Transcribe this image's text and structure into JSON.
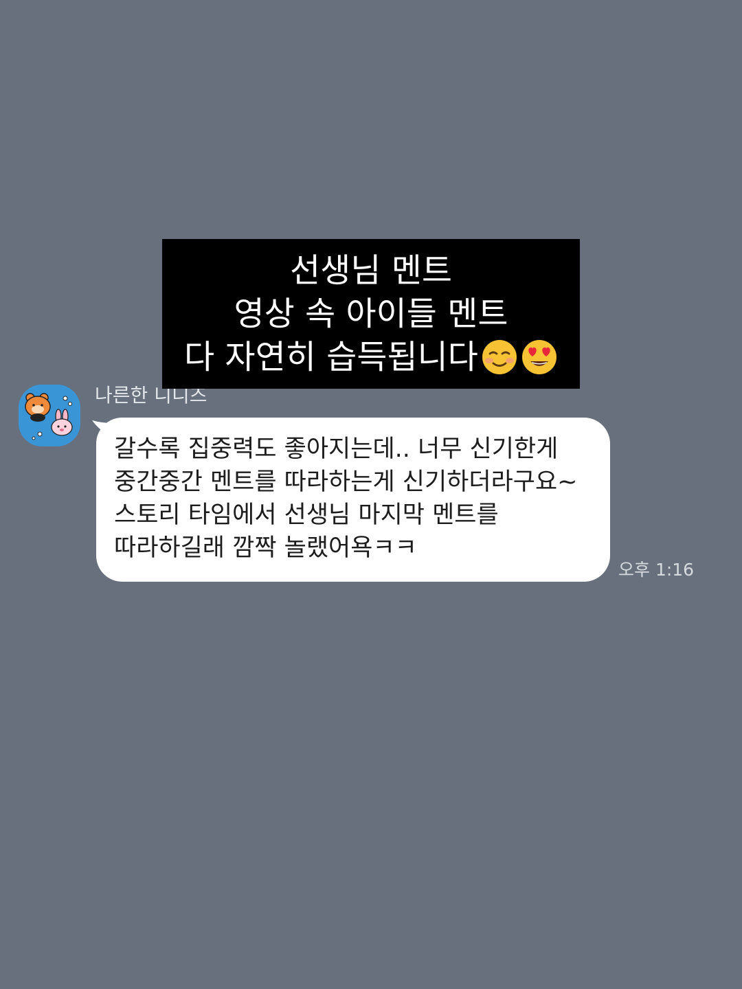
{
  "caption": {
    "lines": [
      "선생님 멘트",
      "영상 속 아이들 멘트",
      "다 자연히 습득됩니다"
    ],
    "emojis": [
      "smiling-face-icon",
      "heart-eyes-icon"
    ]
  },
  "message": {
    "sender": "나른한 니니즈",
    "text": "갈수록 집중력도 좋아지는데.. 너무 신기한게 중간중간 멘트를 따라하는게 신기하더라구요~ 스토리 타임에서 선생님 마지막 멘트를 따라하길래 깜짝 놀랬어욕ㅋㅋ",
    "time": "오후 1:16",
    "avatar": "niniz-sticker-avatar"
  },
  "colors": {
    "background": "#67707c",
    "bubble": "#ffffff",
    "caption_bg": "#000000",
    "avatar_bg": "#3a95d6"
  }
}
